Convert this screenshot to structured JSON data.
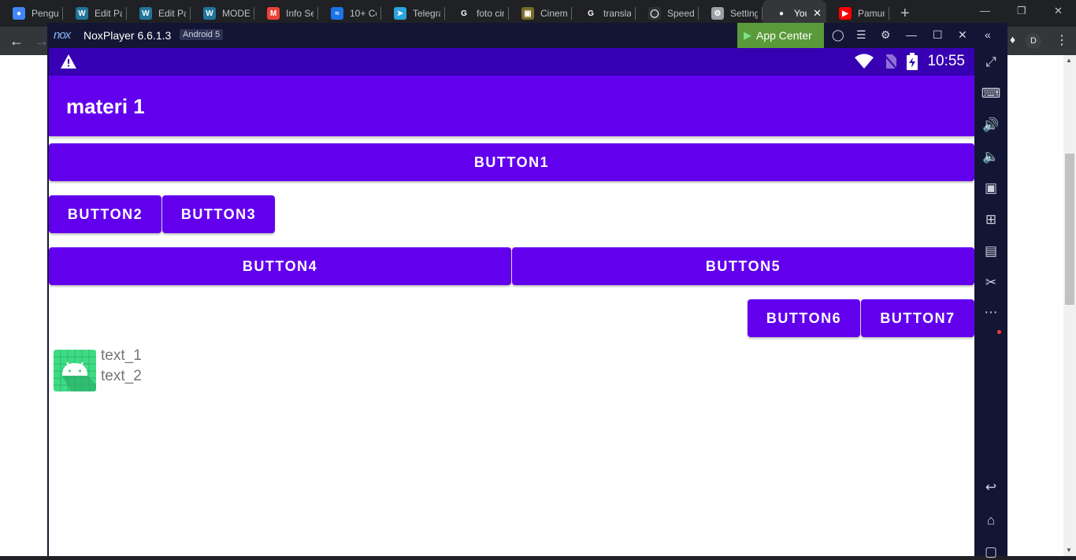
{
  "browser": {
    "tabs": [
      {
        "title": "Pengum",
        "icon": "person-icon",
        "color": "#4285f4"
      },
      {
        "title": "Edit Pag",
        "icon": "wordpress-icon",
        "color": "#21759b"
      },
      {
        "title": "Edit Pag",
        "icon": "wordpress-icon",
        "color": "#21759b"
      },
      {
        "title": "MODEL",
        "icon": "wordpress-icon",
        "color": "#21759b"
      },
      {
        "title": "Info Ser",
        "icon": "gmail-icon",
        "color": "#ea4335"
      },
      {
        "title": "10+ Co",
        "icon": "chart-icon",
        "color": "#1a73e8"
      },
      {
        "title": "Telegra",
        "icon": "telegram-icon",
        "color": "#2aa3df"
      },
      {
        "title": "foto cin",
        "icon": "google-icon",
        "color": "#ffffff"
      },
      {
        "title": "Cinema",
        "icon": "cinema-icon",
        "color": "#7a6a2a"
      },
      {
        "title": "translat",
        "icon": "google-icon",
        "color": "#ffffff"
      },
      {
        "title": "Speedte",
        "icon": "speedtest-icon",
        "color": "#303134"
      },
      {
        "title": "Setting",
        "icon": "gear-icon",
        "color": "#9aa0a6"
      },
      {
        "title": "You",
        "icon": "github-icon",
        "color": "#ffffff",
        "active": true
      },
      {
        "title": "Pamung",
        "icon": "youtube-icon",
        "color": "#ff0000"
      }
    ],
    "profile_initial": "D"
  },
  "nox": {
    "name": "NoxPlayer 6.6.1.3",
    "android_version": "Android 5",
    "app_center": "App Center"
  },
  "android": {
    "time": "10:55",
    "app_title": "materi 1",
    "buttons": {
      "b1": "BUTTON1",
      "b2": "BUTTON2",
      "b3": "BUTTON3",
      "b4": "BUTTON4",
      "b5": "BUTTON5",
      "b6": "BUTTON6",
      "b7": "BUTTON7"
    },
    "text_1": "text_1",
    "text_2": "text_2",
    "colors": {
      "primary": "#6200ee",
      "primary_dark": "#3700b3",
      "launcher_bg": "#3ddc84"
    }
  }
}
